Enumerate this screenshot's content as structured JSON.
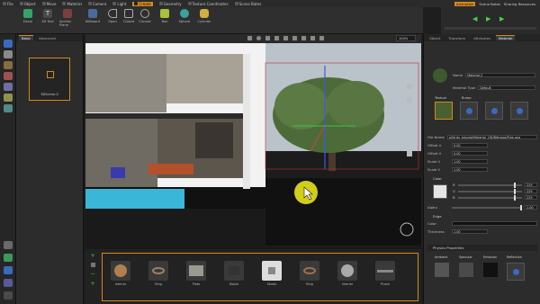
{
  "menubar": {
    "items": [
      "File",
      "Object",
      "Move",
      "Material",
      "Camera",
      "Light",
      "Create",
      "Geometry",
      "Texture Coordinates",
      "Scene Bates"
    ],
    "active_index": 6,
    "right": [
      "Animation",
      "Scene Bates",
      "Sharing Resources"
    ]
  },
  "toolbar": {
    "tools": [
      "Decal",
      "3D Text",
      "Section Plane",
      "Billboard",
      "Open",
      "Closed",
      "Circular",
      "Box",
      "Sphere",
      "Cylinder"
    ],
    "groups": [
      "Create",
      "Path",
      "Shape"
    ]
  },
  "scene_panel": {
    "tabs": [
      "Basic",
      "Advanced"
    ],
    "thumbnail_label": "3DScene-2"
  },
  "viewport": {
    "fov_label": "ISO",
    "zoom": "100%"
  },
  "library": {
    "items": [
      "Interior",
      "Ring",
      "Plate",
      "Robot",
      "Studio",
      "Ring",
      "Interior",
      "PLane"
    ]
  },
  "right_panel": {
    "tabs": [
      "Object",
      "Transform",
      "Attributes",
      "Material"
    ],
    "name_label": "Name",
    "name_value": "Material-2",
    "material_type_label": "Material Type",
    "material_type_value": "Default",
    "texture_label": "Texture",
    "bump_label": "Bump",
    "file_name_label": "File Name",
    "file_name_value": "ai/Urdu_tutorial/Material_2/D/Bitmaps/Tree.png",
    "offset_u_label": "Offset U",
    "offset_u_value": "0.00",
    "offset_v_label": "Offset V",
    "offset_v_value": "0.00",
    "scale_u_label": "Scale U",
    "scale_u_value": "1.00",
    "scale_v_label": "Scale V",
    "scale_v_value": "1.00",
    "color_label": "Color",
    "rgb": [
      "R",
      "G",
      "B"
    ],
    "rgb_values": [
      "229",
      "229",
      "229"
    ],
    "alpha_label": "Alpha",
    "alpha_value": "1.00",
    "edge_label": "Edge",
    "edge_color_label": "Color",
    "thickness_label": "Thickness",
    "thickness_value": "1.00",
    "physics_label": "Physics Properties",
    "ambient_label": "Ambient",
    "specular_label": "Specular",
    "emission_label": "Emission",
    "reflection_label": "Reflection"
  },
  "colors": {
    "accent": "#d08a1c",
    "cursor": "#e8e21a",
    "sky": "#b9c3c9"
  }
}
